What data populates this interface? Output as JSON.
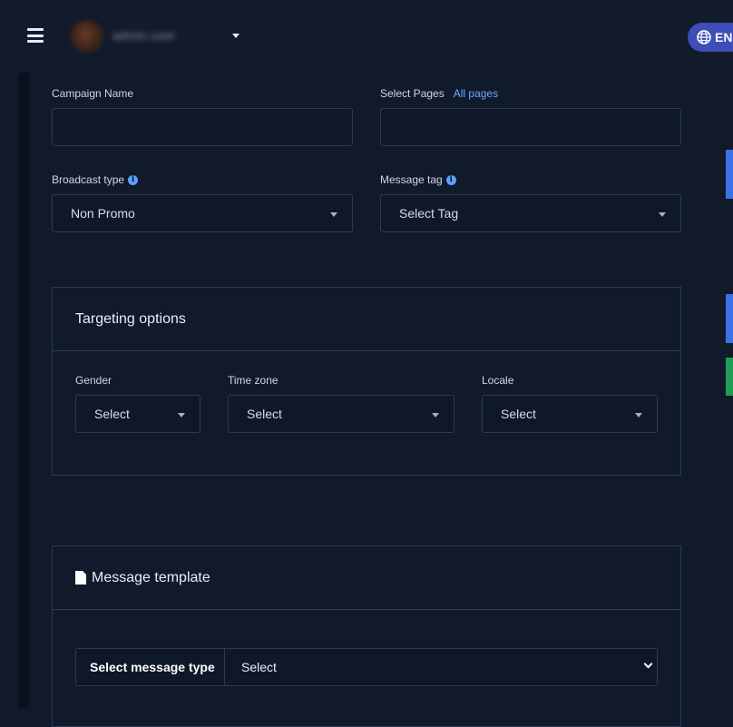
{
  "header": {
    "username": "admin user",
    "language": "EN"
  },
  "form": {
    "campaign_name_label": "Campaign Name",
    "select_pages_label": "Select Pages",
    "all_pages_link": "All pages",
    "broadcast_type_label": "Broadcast type",
    "broadcast_type_value": "Non Promo",
    "message_tag_label": "Message tag",
    "message_tag_value": "Select Tag"
  },
  "targeting": {
    "title": "Targeting options",
    "gender_label": "Gender",
    "gender_value": "Select",
    "timezone_label": "Time zone",
    "timezone_value": "Select",
    "locale_label": "Locale",
    "locale_value": "Select"
  },
  "template": {
    "title": "Message template",
    "message_type_label": "Select message type",
    "message_type_value": "Select"
  },
  "colors": {
    "background": "#111a2b",
    "accent": "#3f4db8",
    "link": "#6ea8ff",
    "border": "#2d3a52"
  }
}
